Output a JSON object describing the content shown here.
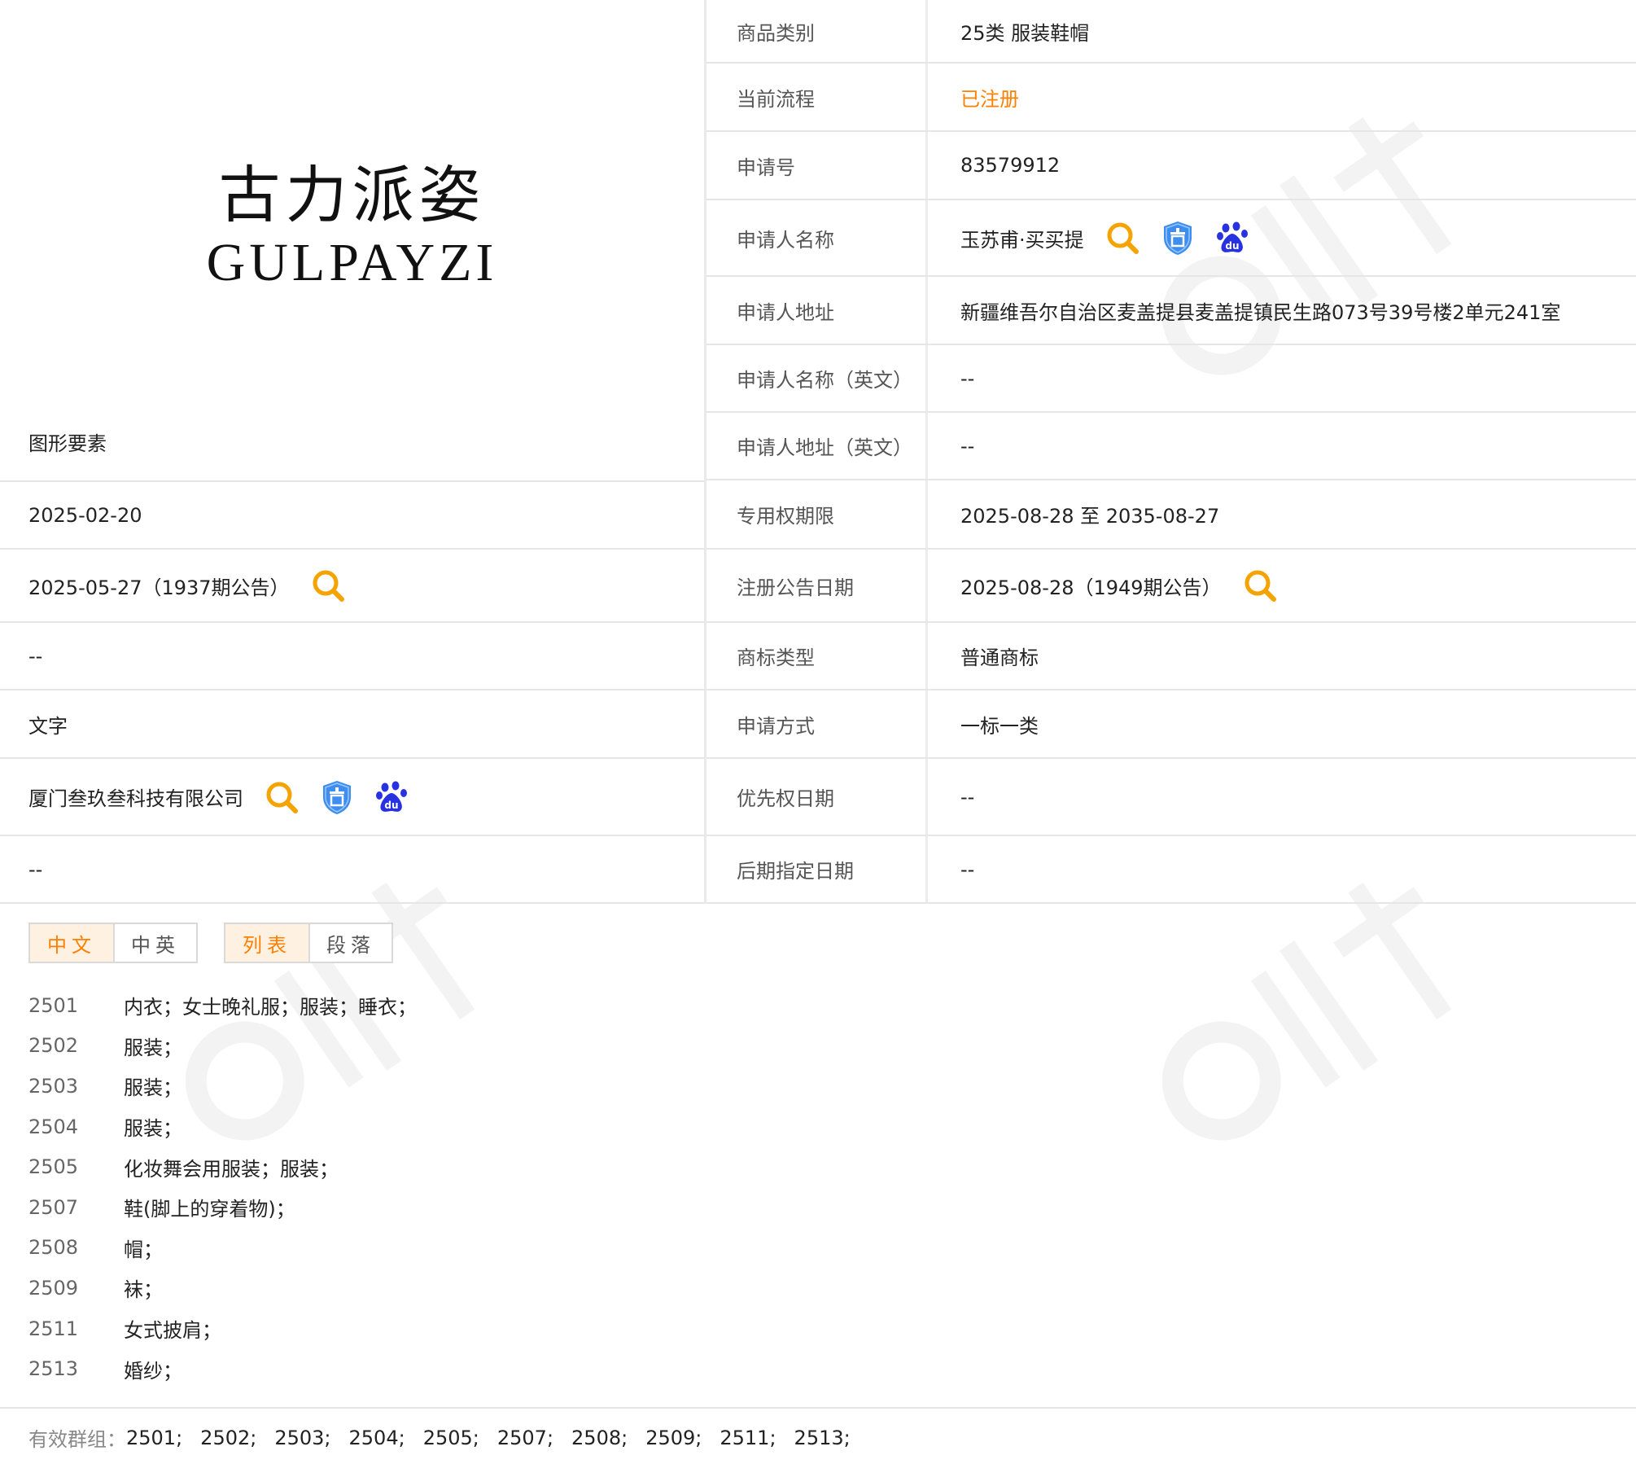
{
  "logo": {
    "chinese": "古力派姿",
    "english": "GULPAYZI"
  },
  "left": {
    "graphic_elements_label": "图形要素",
    "application_date": "2025-02-20",
    "preliminary_announcement": "2025-05-27（1937期公告）",
    "row3": "--",
    "trademark_form": "文字",
    "agent": "厦门叁玖叁科技有限公司",
    "row6": "--"
  },
  "right": {
    "rows": [
      {
        "label": "商品类别",
        "value": "25类 服装鞋帽"
      },
      {
        "label": "当前流程",
        "value": "已注册"
      },
      {
        "label": "申请号",
        "value": "83579912"
      },
      {
        "label": "申请人名称",
        "value": "玉苏甫·买买提"
      },
      {
        "label": "申请人地址",
        "value": "新疆维吾尔自治区麦盖提县麦盖提镇民生路073号39号楼2单元241室"
      },
      {
        "label": "申请人名称（英文）",
        "value": "--"
      },
      {
        "label": "申请人地址（英文）",
        "value": "--"
      },
      {
        "label": "专用权期限",
        "value": "2025-08-28 至 2035-08-27"
      },
      {
        "label": "注册公告日期",
        "value": "2025-08-28（1949期公告）"
      },
      {
        "label": "商标类型",
        "value": "普通商标"
      },
      {
        "label": "申请方式",
        "value": "一标一类"
      },
      {
        "label": "优先权日期",
        "value": "--"
      },
      {
        "label": "后期指定日期",
        "value": "--"
      }
    ]
  },
  "toggles": {
    "language": [
      "中文",
      "中英"
    ],
    "view": [
      "列表",
      "段落"
    ]
  },
  "goods": [
    {
      "code": "2501",
      "text": "内衣；女士晚礼服；服装；睡衣；"
    },
    {
      "code": "2502",
      "text": "服装；"
    },
    {
      "code": "2503",
      "text": "服装；"
    },
    {
      "code": "2504",
      "text": "服装；"
    },
    {
      "code": "2505",
      "text": "化妆舞会用服装；服装；"
    },
    {
      "code": "2507",
      "text": "鞋(脚上的穿着物)；"
    },
    {
      "code": "2508",
      "text": "帽；"
    },
    {
      "code": "2509",
      "text": "袜；"
    },
    {
      "code": "2511",
      "text": "女式披肩；"
    },
    {
      "code": "2513",
      "text": "婚纱；"
    }
  ],
  "valid_groups": {
    "label": "有效群组：",
    "items": [
      "2501;",
      "2502;",
      "2503;",
      "2504;",
      "2505;",
      "2507;",
      "2508;",
      "2509;",
      "2511;",
      "2513;"
    ]
  },
  "colors": {
    "accent": "#ff7f00",
    "badge_blue": "#3d8ef0",
    "baidu_blue": "#2932e1",
    "divider": "#e6e6e6"
  },
  "icons": {
    "search": "search-icon",
    "trademark": "trademark-shield-icon",
    "baidu": "baidu-paw-icon"
  }
}
